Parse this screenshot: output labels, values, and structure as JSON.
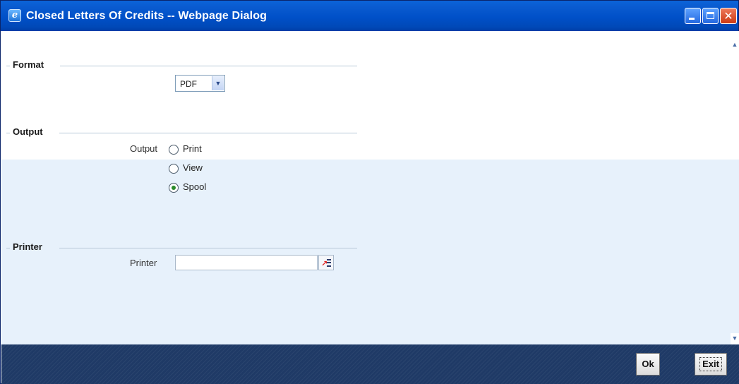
{
  "window": {
    "title": "Closed Letters Of Credits -- Webpage Dialog",
    "title_icon": "ie-icon",
    "controls": [
      "minimize",
      "maximize",
      "close"
    ],
    "close_glyph": "✕"
  },
  "sections": {
    "format": {
      "label": "Format",
      "select": {
        "value": "PDF",
        "dropdown_glyph": "▼"
      }
    },
    "output": {
      "label": "Output",
      "field_label": "Output",
      "options": [
        {
          "label": "Print",
          "checked": false
        },
        {
          "label": "View",
          "checked": false
        },
        {
          "label": "Spool",
          "checked": true
        }
      ]
    },
    "printer": {
      "label": "Printer",
      "field_label": "Printer",
      "value": ""
    }
  },
  "footer": {
    "ok_label": "Ok",
    "exit_label": "Exit"
  },
  "colors": {
    "titlebar": "#0050c8",
    "panel_lower": "#e7f1fb",
    "footer": "#1f3a66",
    "radio_checked": "#2a8a2a"
  }
}
